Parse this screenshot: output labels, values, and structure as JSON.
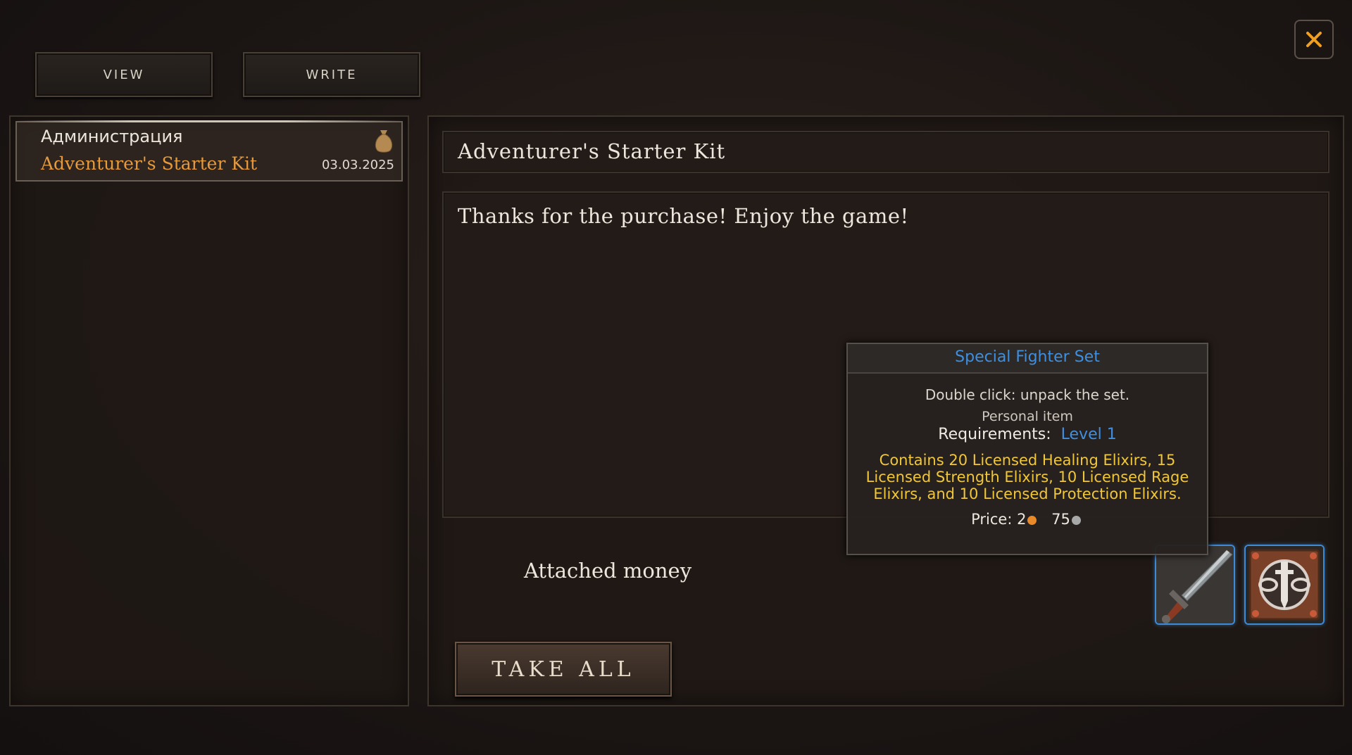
{
  "tabs": {
    "view_label": "VIEW",
    "write_label": "WRITE"
  },
  "mail_list": {
    "items": [
      {
        "sender": "Администрация",
        "subject": "Adventurer's Starter Kit",
        "date": "03.03.2025",
        "icon": "money-bag-icon"
      }
    ]
  },
  "mail": {
    "subject": "Adventurer's Starter Kit",
    "body": "Thanks for the purchase! Enjoy the game!",
    "attached_money_label": "Attached money",
    "take_all_label": "TAKE ALL",
    "attachments": [
      {
        "icon": "sword-icon"
      },
      {
        "icon": "shield-emblem-icon"
      }
    ]
  },
  "tooltip": {
    "title": "Special Fighter Set",
    "hint": "Double click: unpack the set.",
    "binding": "Personal item",
    "requirements_label": "Requirements:",
    "requirements_value": "Level 1",
    "description": "Contains 20 Licensed Healing Elixirs, 15 Licensed Strength Elixirs, 10 Licensed Rage Elixirs, and 10 Licensed Protection Elixirs.",
    "price_label": "Price:",
    "price_gold": "2",
    "price_silver": "75"
  },
  "colors": {
    "accent_orange": "#e69a3c",
    "link_blue": "#3f8fe0",
    "desc_yellow": "#f0c63a",
    "close_x": "#f0a020"
  }
}
